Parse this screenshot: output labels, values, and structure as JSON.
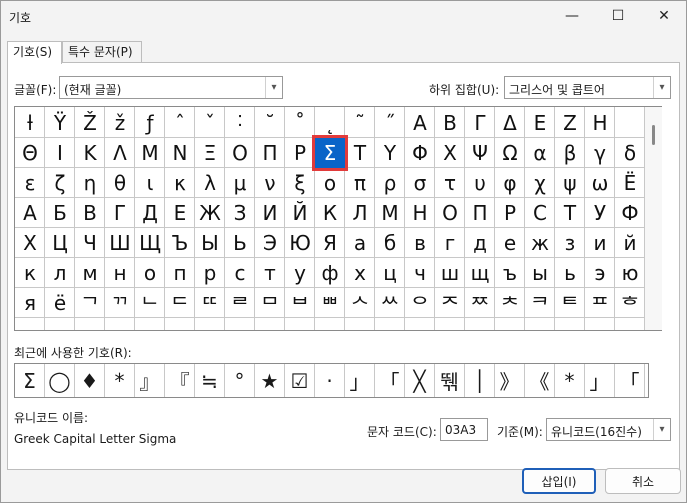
{
  "window": {
    "title": "기호",
    "minimize": "—",
    "maximize": "☐",
    "close": "✕"
  },
  "tabs": [
    "기호(S)",
    "특수 문자(P)"
  ],
  "font_label": "글꼴(F):",
  "font_value": "(현재 글꼴)",
  "subset_label": "하위 집합(U):",
  "subset_value": "그리스어 및 콥트어",
  "symbols": [
    [
      "ƚ",
      "Ÿ",
      "Ž",
      "ž",
      "ƒ",
      "ˆ",
      "ˇ",
      "˸",
      "˘",
      "˚",
      "˛",
      "˜",
      "˝",
      "Α",
      "Β",
      "Γ",
      "Δ",
      "Ε",
      "Ζ",
      "Η"
    ],
    [
      "Θ",
      "Ι",
      "Κ",
      "Λ",
      "Μ",
      "Ν",
      "Ξ",
      "Ο",
      "Π",
      "Ρ",
      "Σ",
      "Τ",
      "Υ",
      "Φ",
      "Χ",
      "Ψ",
      "Ω",
      "α",
      "β",
      "γ",
      "δ"
    ],
    [
      "ε",
      "ζ",
      "η",
      "θ",
      "ι",
      "κ",
      "λ",
      "μ",
      "ν",
      "ξ",
      "ο",
      "π",
      "ρ",
      "σ",
      "τ",
      "υ",
      "φ",
      "χ",
      "ψ",
      "ω",
      "Ё"
    ],
    [
      "А",
      "Б",
      "В",
      "Г",
      "Д",
      "Е",
      "Ж",
      "З",
      "И",
      "Й",
      "К",
      "Л",
      "М",
      "Н",
      "О",
      "П",
      "Р",
      "С",
      "Т",
      "У",
      "Ф"
    ],
    [
      "Х",
      "Ц",
      "Ч",
      "Ш",
      "Щ",
      "Ъ",
      "Ы",
      "Ь",
      "Э",
      "Ю",
      "Я",
      "а",
      "б",
      "в",
      "г",
      "д",
      "е",
      "ж",
      "з",
      "и",
      "й"
    ],
    [
      "к",
      "л",
      "м",
      "н",
      "о",
      "п",
      "р",
      "с",
      "т",
      "у",
      "ф",
      "х",
      "ц",
      "ч",
      "ш",
      "щ",
      "ъ",
      "ы",
      "ь",
      "э",
      "ю"
    ],
    [
      "я",
      "ё",
      "ᄀ",
      "ᄁ",
      "ᄂ",
      "ᄃ",
      "ᄄ",
      "ᄅ",
      "ᄆ",
      "ᄇ",
      "ᄈ",
      "ᄉ",
      "ᄊ",
      "ᄋ",
      "ᄌ",
      "ᄍ",
      "ᄎ",
      "ᄏ",
      "ᄐ",
      "ᄑ",
      "ᄒ"
    ]
  ],
  "selected_symbol": "Σ",
  "recent_label": "최근에 사용한 기호(R):",
  "recent": [
    "Σ",
    "◯",
    "♦",
    "*",
    "』",
    "『",
    "≒",
    "°",
    "★",
    "☑",
    "·",
    "」",
    "「",
    "╳",
    "뛖",
    "│",
    "》",
    "《",
    "*",
    "」",
    "「"
  ],
  "unicode_name_label": "유니코드 이름:",
  "unicode_name": "Greek Capital Letter Sigma",
  "char_code_label": "문자 코드(C):",
  "char_code": "03A3",
  "from_label": "기준(M):",
  "from_value": "유니코드(16진수)",
  "insert_button": "삽입(I)",
  "cancel_button": "취소"
}
